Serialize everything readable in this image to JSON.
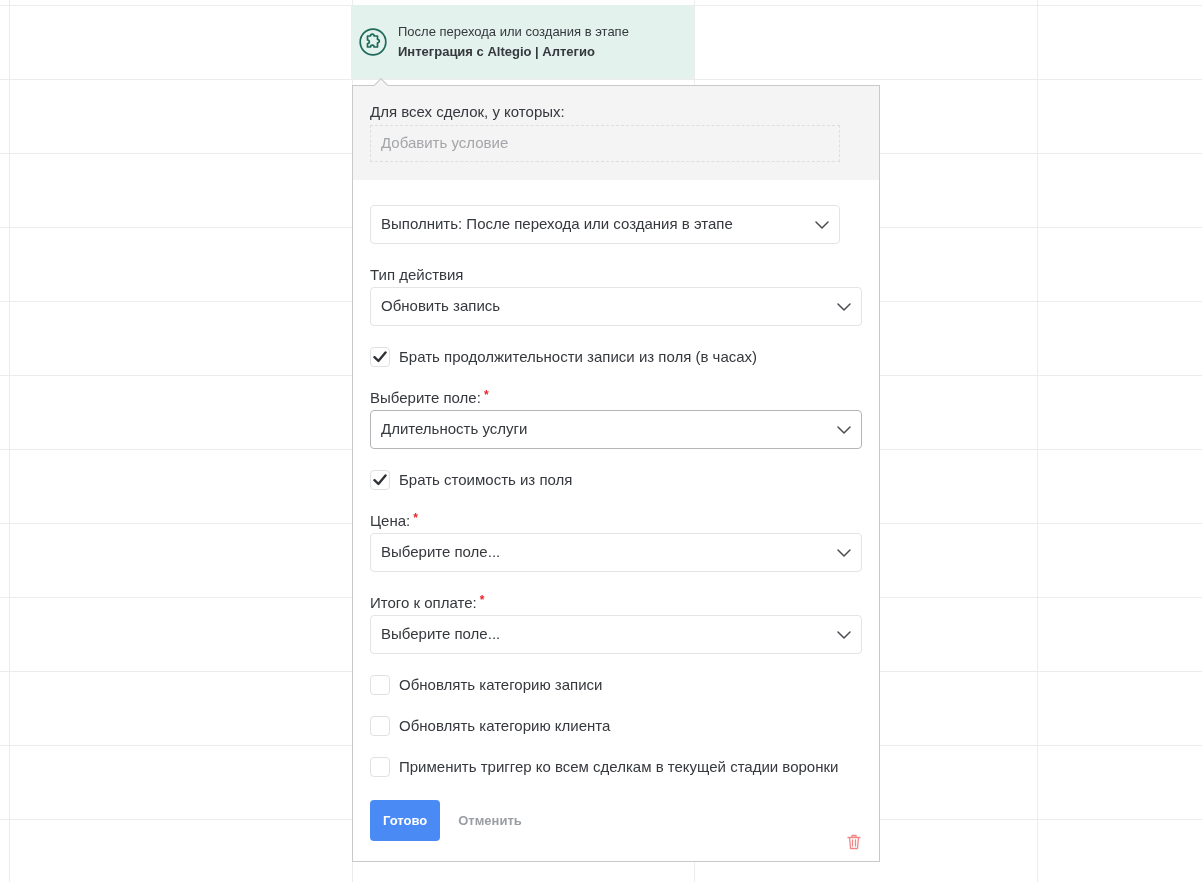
{
  "trigger": {
    "title": "После перехода или создания в этапе",
    "stage": "Интеграция с Altegio | Алтегио"
  },
  "popup": {
    "conditions": {
      "label": "Для всех сделок, у которых:",
      "placeholder": "Добавить условие"
    },
    "run_select": {
      "value": "Выполнить: После перехода или создания в этапе"
    },
    "fields": [
      {
        "kind": "select",
        "label": "Тип действия",
        "value": "Обновить запись",
        "focused": false
      },
      {
        "kind": "checkbox",
        "label": "Брать продолжительности записи из поля (в часах)",
        "checked": true
      },
      {
        "kind": "select",
        "label": "Выберите поле:",
        "mark": "*",
        "value": "Длительность услуги",
        "focused": true
      },
      {
        "kind": "checkbox",
        "label": "Брать стоимость из поля",
        "checked": true
      },
      {
        "kind": "select",
        "label": "Цена:",
        "mark": "*",
        "placeholder": "Выберите поле...",
        "focused": false
      },
      {
        "kind": "select",
        "label": "Итого к оплате:",
        "mark": "*",
        "placeholder": "Выберите поле...",
        "focused": false
      },
      {
        "kind": "checkbox",
        "label": "Обновлять категорию записи",
        "checked": false
      },
      {
        "kind": "checkbox",
        "label": "Обновлять категорию клиента",
        "checked": false
      },
      {
        "kind": "checkbox",
        "label": "Применить триггер ко всем сделкам в текущей стадии воронки",
        "checked": false
      }
    ],
    "buttons": [
      {
        "kind": "primary",
        "label": "Готово"
      },
      {
        "kind": "cancel",
        "label": "Отменить"
      }
    ]
  }
}
